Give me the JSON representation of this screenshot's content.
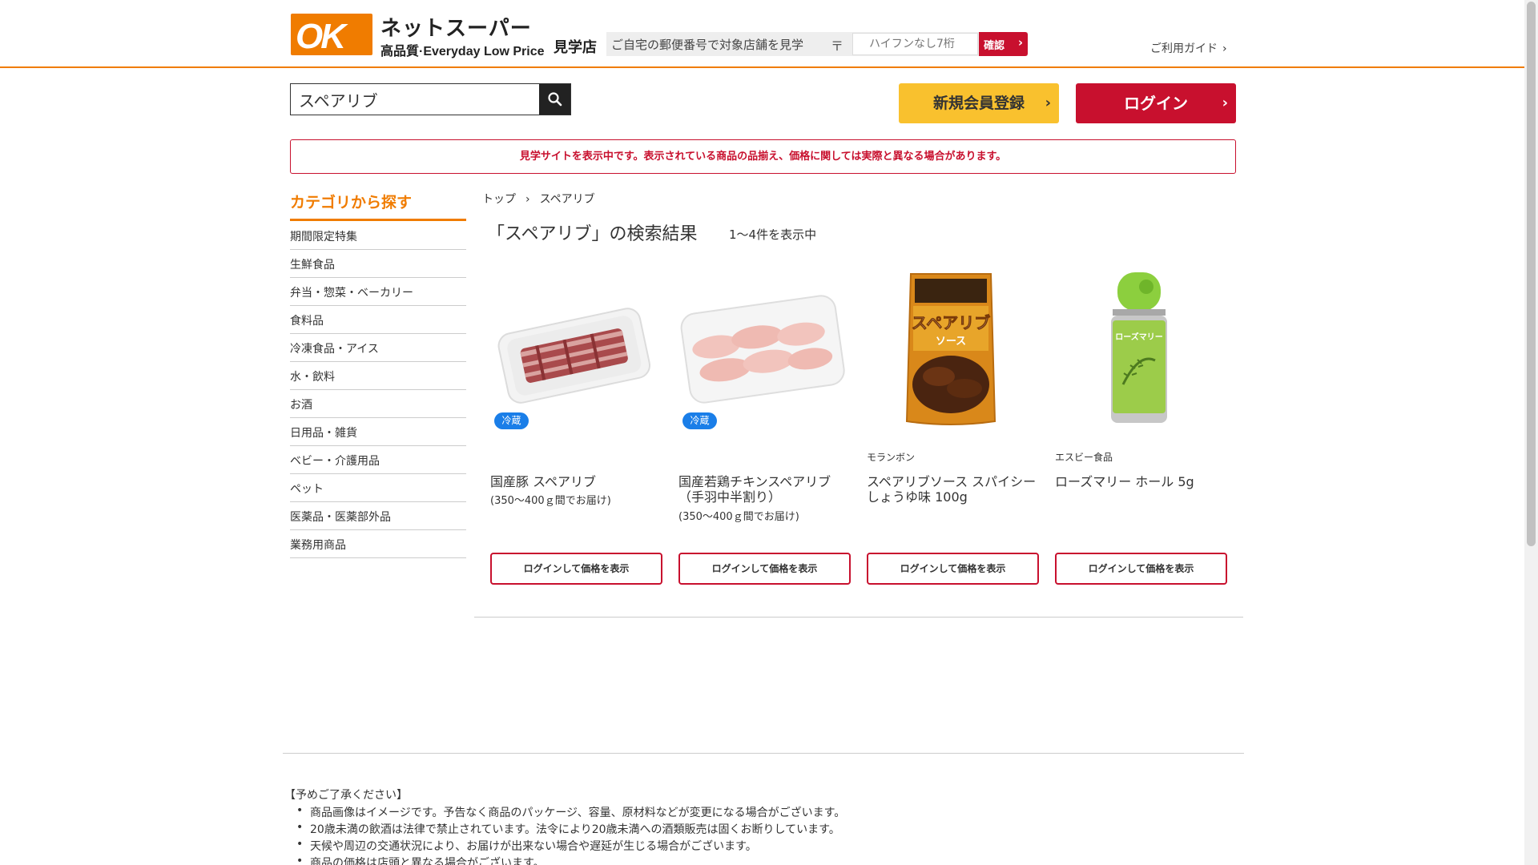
{
  "header": {
    "logo_mark": "OK",
    "logo_title": "ネットスーパー",
    "logo_sub": "高品質·Everyday Low Price",
    "store_label": "見学店",
    "zip_prompt": "ご自宅の郵便番号で対象店舗を見学",
    "zip_mark": "〒",
    "zip_placeholder": "ハイフンなし7桁",
    "zip_button": "確認",
    "guide_link": "ご利用ガイド"
  },
  "search": {
    "value": "スペアリブ"
  },
  "auth": {
    "register": "新規会員登録",
    "login": "ログイン"
  },
  "notice": "見学サイトを表示中です。表示されている商品の品揃え、価格に関しては実際と異なる場合があります。",
  "sidebar": {
    "title": "カテゴリから探す",
    "items": [
      "期間限定特集",
      "生鮮食品",
      "弁当・惣菜・ベーカリー",
      "食料品",
      "冷凍食品・アイス",
      "水・飲料",
      "お酒",
      "日用品・雑貨",
      "ベビー・介護用品",
      "ペット",
      "医薬品・医薬部外品",
      "業務用商品"
    ]
  },
  "breadcrumb": {
    "home": "トップ",
    "separator": "›",
    "current": "スペアリブ"
  },
  "results": {
    "title": "「スペアリブ」の検索結果",
    "count": "1～4件を表示中"
  },
  "products": [
    {
      "badge": "冷蔵",
      "maker": "",
      "name": "国産豚 スペアリブ",
      "note": "(350～400ｇ間でお届け)",
      "button": "ログインして価格を表示",
      "image": "pork-spareribs-tray"
    },
    {
      "badge": "冷蔵",
      "maker": "",
      "name": "国産若鶏チキンスペアリブ（手羽中半割り）",
      "note": "(350～400ｇ間でお届け)",
      "button": "ログインして価格を表示",
      "image": "chicken-spareribs-tray"
    },
    {
      "badge": "",
      "maker": "モランボン",
      "name": "スペアリブソース スパイシーしょうゆ味 100g",
      "note": "",
      "button": "ログインして価格を表示",
      "image": "sauce-pouch",
      "pouch_text": "スペアリブ",
      "pouch_text2": "ソース"
    },
    {
      "badge": "",
      "maker": "エスビー食品",
      "name": "ローズマリー ホール 5g",
      "note": "",
      "button": "ログインして価格を表示",
      "image": "rosemary-bottle",
      "bottle_text": "ローズマリー"
    }
  ],
  "footer": {
    "heading": "【予めご了承ください】",
    "items": [
      "商品画像はイメージです。予告なく商品のパッケージ、容量、原材料などが変更になる場合がございます。",
      "20歳未満の飲酒は法律で禁止されています。法令により20歳未満への酒類販売は固くお断りしています。",
      "天候や周辺の交通状況により、お届けが出来ない場合や遅延が生じる場合がございます。",
      "商品の価格は店頭と異なる場合がございます。"
    ]
  },
  "colors": {
    "brand_orange": "#f07c00",
    "brand_red": "#c8102e",
    "register_yellow": "#f9c12e",
    "badge_blue": "#1a7ee8"
  }
}
